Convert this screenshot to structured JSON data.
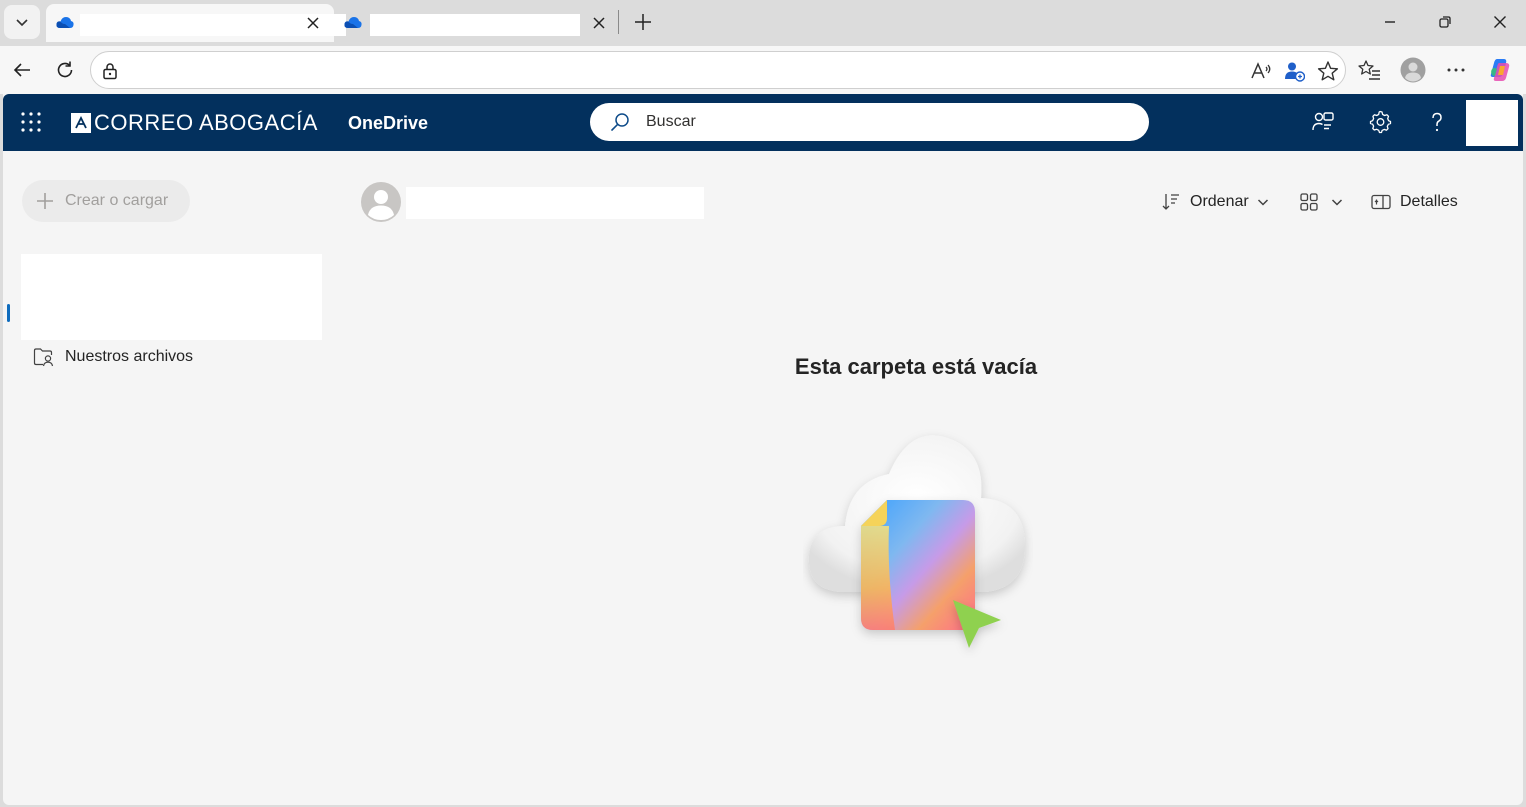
{
  "browser": {
    "tabs": [
      {
        "title": "",
        "active": true
      },
      {
        "title": "",
        "active": false
      }
    ],
    "address": ""
  },
  "suite_header": {
    "brand": "CORREO ABOGACÍA",
    "app_name": "OneDrive",
    "search_placeholder": "Buscar"
  },
  "left_nav": {
    "create_label": "Crear o cargar",
    "items": [
      {
        "label": "Nuestros archivos",
        "icon": "shared-folder-icon"
      }
    ]
  },
  "commands": {
    "sort_label": "Ordenar",
    "details_label": "Detalles"
  },
  "empty_state": {
    "title": "Esta carpeta está vacía"
  },
  "colors": {
    "suite_header": "#03305d",
    "accent": "#0f6cbd",
    "background": "#f5f5f5"
  }
}
